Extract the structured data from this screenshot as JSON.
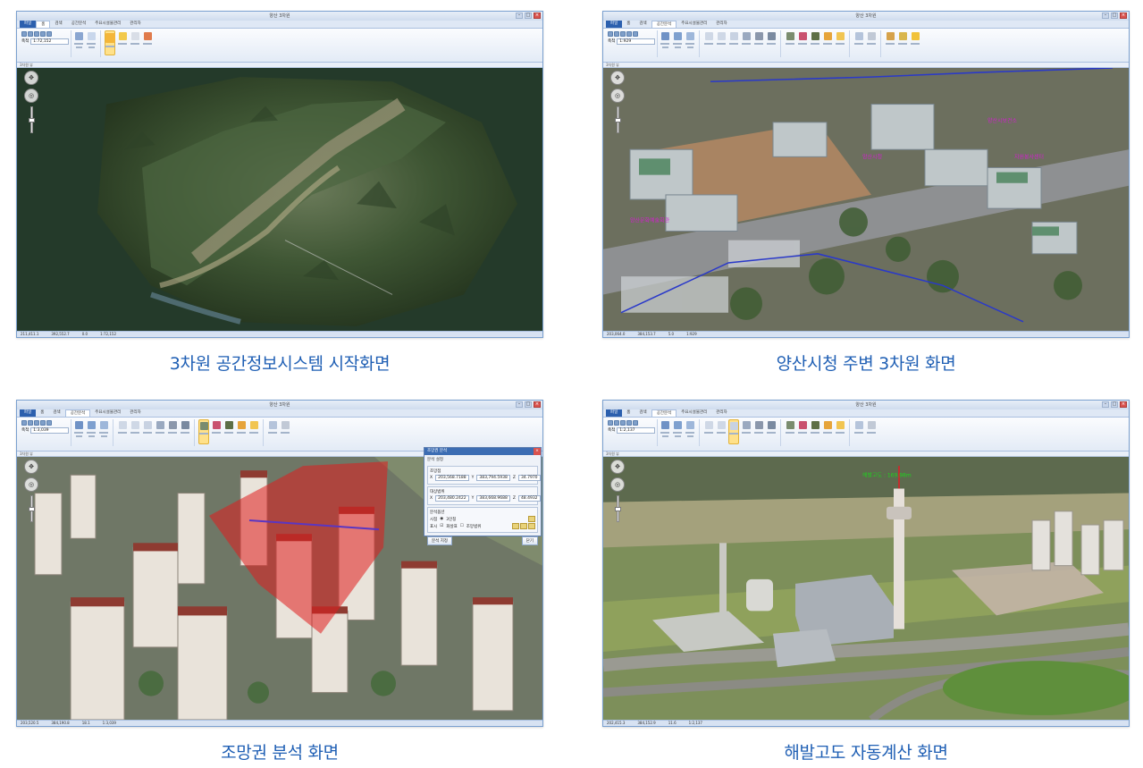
{
  "app": {
    "window_title": "양산 3차원",
    "tabs_basic": [
      "파일",
      "홈",
      "검색",
      "공간분석",
      "주요시설물관리",
      "관리자"
    ],
    "tabs_analysis": [
      "파일",
      "홈",
      "검색",
      "공간분석",
      "주요시설물관리",
      "관리자"
    ],
    "layer_panel_label": "3차원 뷰"
  },
  "panels": [
    {
      "caption": "3차원 공간정보시스템 시작화면",
      "scale_label": "축척",
      "scale_value": "1:72,152",
      "status": [
        "211,411.1",
        "392,552.7",
        "0.0",
        "1:72,152"
      ]
    },
    {
      "caption": "양산시청 주변 3차원 화면",
      "scale_label": "축척",
      "scale_value": "1:929",
      "status": [
        "203,064.0",
        "384,153.7",
        "5.0",
        "1:929"
      ],
      "labels": [
        "양산시청",
        "양산문화예술회관",
        "양산시보건소",
        "자원봉사센터"
      ]
    },
    {
      "caption": "조망권 분석 화면",
      "scale_label": "축척",
      "scale_value": "1:3,039",
      "status": [
        "203,520.5",
        "384,190.8",
        "18.1",
        "1:3,039"
      ],
      "dialog": {
        "title": "조망권 분석",
        "subtitle": "분석 설정",
        "start_group": "조망점",
        "target_group": "대상범위",
        "start_x": "203,568.7188",
        "start_y": "383,794.5938",
        "start_z": "34.7970",
        "target_x": "203,480.2422",
        "target_y": "383,668.9688",
        "target_z": "48.4932",
        "option_group": "분석옵션",
        "option_view": "시점",
        "option_display": "표시",
        "radio_label": "3인칭",
        "check1": "화살표",
        "check2": "조망범위",
        "run_button": "분석 지정",
        "close_button": "닫기"
      }
    },
    {
      "caption": "해발고도 자동계산 화면",
      "scale_label": "축척",
      "scale_value": "1:2,137",
      "status": [
        "202,415.3",
        "384,152.9",
        "11.6",
        "1:2,137"
      ],
      "elevation_label": "해발고도 : 169.98m"
    }
  ]
}
